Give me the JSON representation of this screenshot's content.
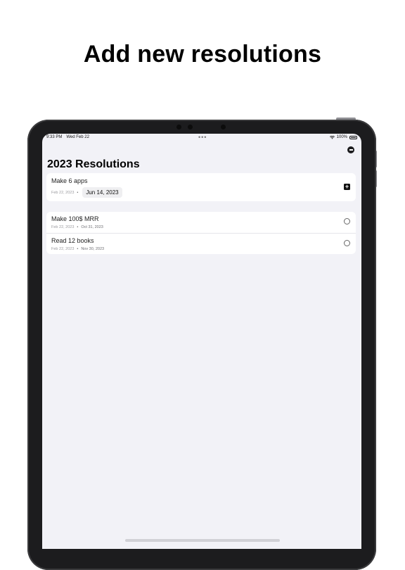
{
  "headline": "Add new resolutions",
  "status_bar": {
    "time": "9:33 PM",
    "date": "Wed Feb 22",
    "battery": "100%",
    "multitask_dots": "•••"
  },
  "page": {
    "title": "2023 Resolutions"
  },
  "new_resolution": {
    "title": "Make 6 apps",
    "start_date": "Feb 22, 2023",
    "separator": "•",
    "end_date": "Jun 14, 2023",
    "add_icon": "plus-square-icon"
  },
  "resolutions": [
    {
      "title": "Make 100$ MRR",
      "start_date": "Feb 22, 2023",
      "separator": "•",
      "end_date": "Oct 31, 2023"
    },
    {
      "title": "Read 12 books",
      "start_date": "Feb 22, 2023",
      "separator": "•",
      "end_date": "Nov 30, 2023"
    }
  ],
  "icons": {
    "remove": "minus-circle-icon",
    "checkbox": "circle-icon",
    "wifi": "wifi-icon",
    "battery": "battery-icon"
  },
  "colors": {
    "background": "#ffffff",
    "screen": "#f2f2f7",
    "device_frame": "#1c1c1e",
    "accent": "#111111"
  }
}
